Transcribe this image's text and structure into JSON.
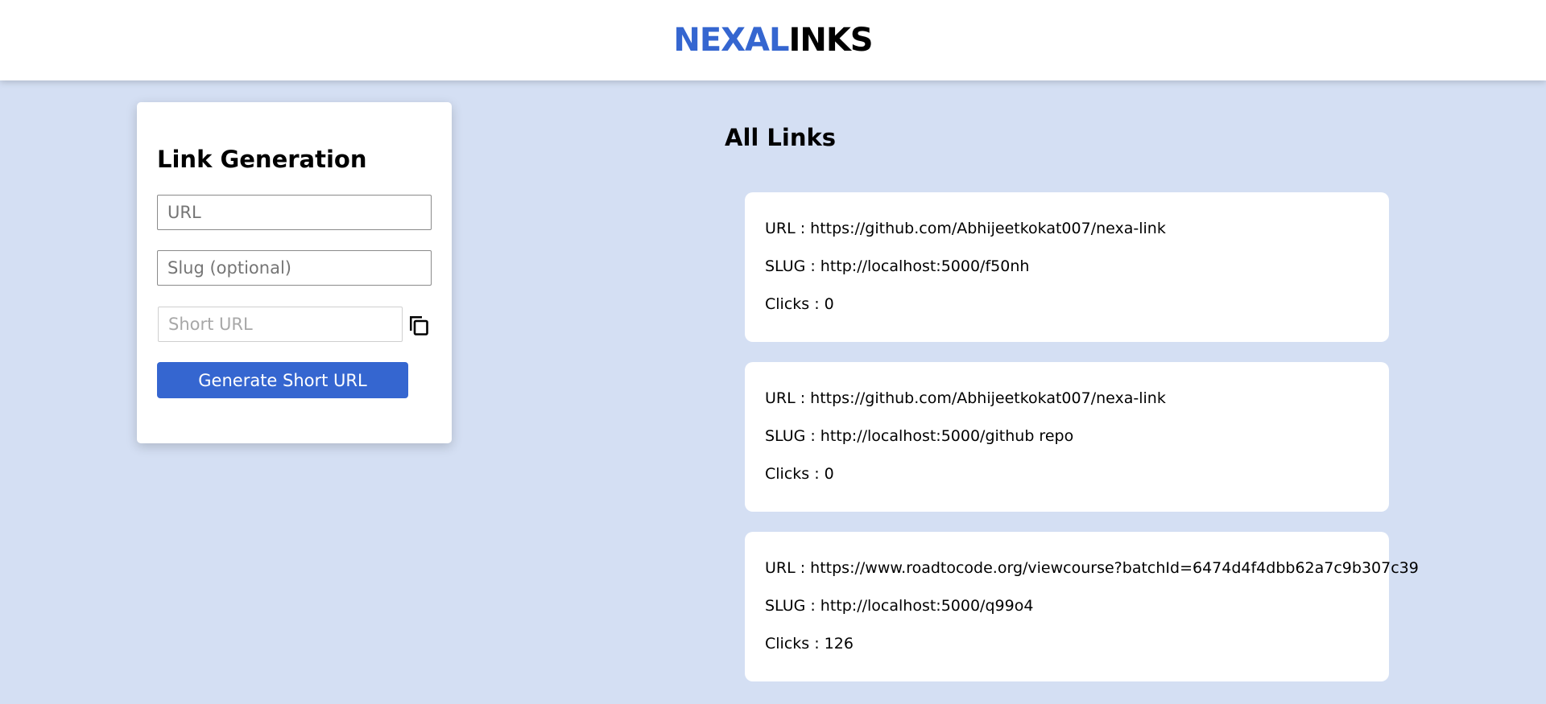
{
  "header": {
    "logo_brand": "NEXAL",
    "logo_rest": "INKS"
  },
  "generator": {
    "title": "Link Generation",
    "url_placeholder": "URL",
    "slug_placeholder": "Slug (optional)",
    "short_placeholder": "Short URL",
    "copy_icon": "copy-icon",
    "button_label": "Generate Short URL"
  },
  "links": {
    "title": "All Links",
    "items": [
      {
        "url": "URL : https://github.com/Abhijeetkokat007/nexa-link",
        "slug": "SLUG : http://localhost:5000/f50nh",
        "clicks": "Clicks : 0"
      },
      {
        "url": "URL : https://github.com/Abhijeetkokat007/nexa-link",
        "slug": "SLUG : http://localhost:5000/github repo",
        "clicks": "Clicks : 0"
      },
      {
        "url": "URL : https://www.roadtocode.org/viewcourse?batchId=6474d4f4dbb62a7c9b307c39",
        "slug": "SLUG : http://localhost:5000/q99o4",
        "clicks": "Clicks : 126"
      }
    ]
  },
  "colors": {
    "accent": "#3566d0",
    "background": "#d4dff3"
  }
}
